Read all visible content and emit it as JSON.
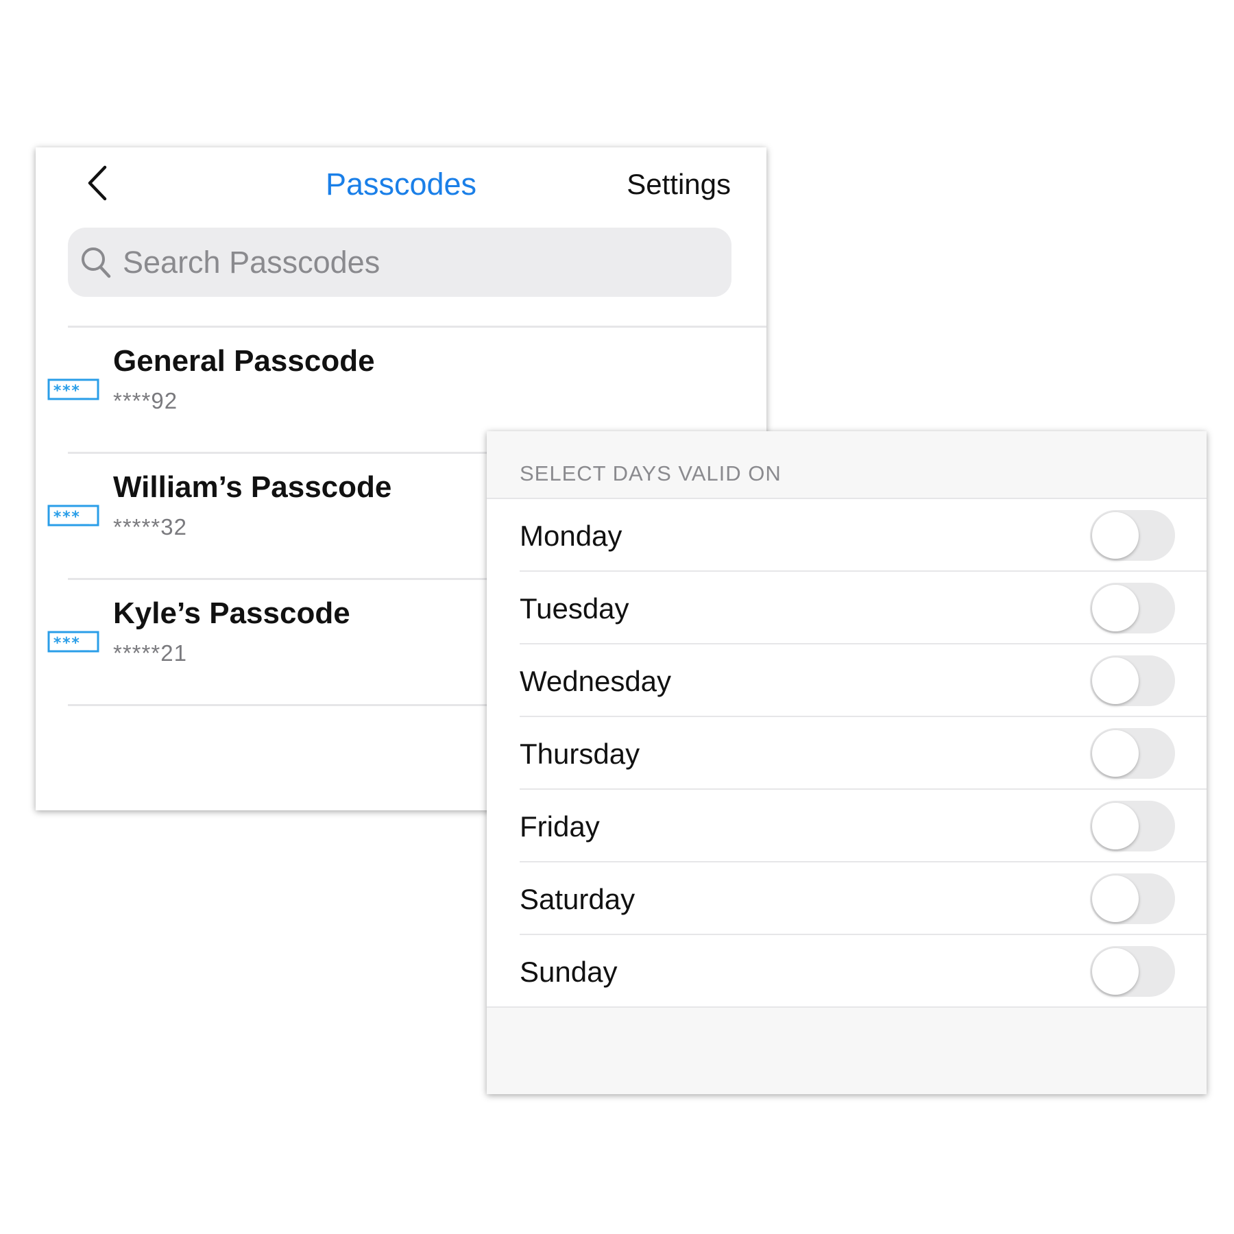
{
  "passcodes_screen": {
    "nav": {
      "title": "Passcodes",
      "settings_label": "Settings",
      "back_icon": "chevron-left-icon"
    },
    "search": {
      "placeholder": "Search Passcodes",
      "value": "",
      "icon": "search-icon"
    },
    "items": [
      {
        "name": "General Passcode",
        "code": "****92",
        "icon": "passcode-field-icon"
      },
      {
        "name": "William’s Passcode",
        "code": "*****32",
        "icon": "passcode-field-icon"
      },
      {
        "name": "Kyle’s Passcode",
        "code": "*****21",
        "icon": "passcode-field-icon"
      }
    ]
  },
  "days_screen": {
    "section_header": "SELECT DAYS VALID ON",
    "days": [
      {
        "label": "Monday",
        "enabled": false
      },
      {
        "label": "Tuesday",
        "enabled": false
      },
      {
        "label": "Wednesday",
        "enabled": false
      },
      {
        "label": "Thursday",
        "enabled": false
      },
      {
        "label": "Friday",
        "enabled": false
      },
      {
        "label": "Saturday",
        "enabled": false
      },
      {
        "label": "Sunday",
        "enabled": false
      }
    ]
  },
  "colors": {
    "accent": "#1a7fe8",
    "icon_blue": "#2a9ee8",
    "toggle_off": "#e9e9ea",
    "secondary_text": "#8a8a8e"
  }
}
